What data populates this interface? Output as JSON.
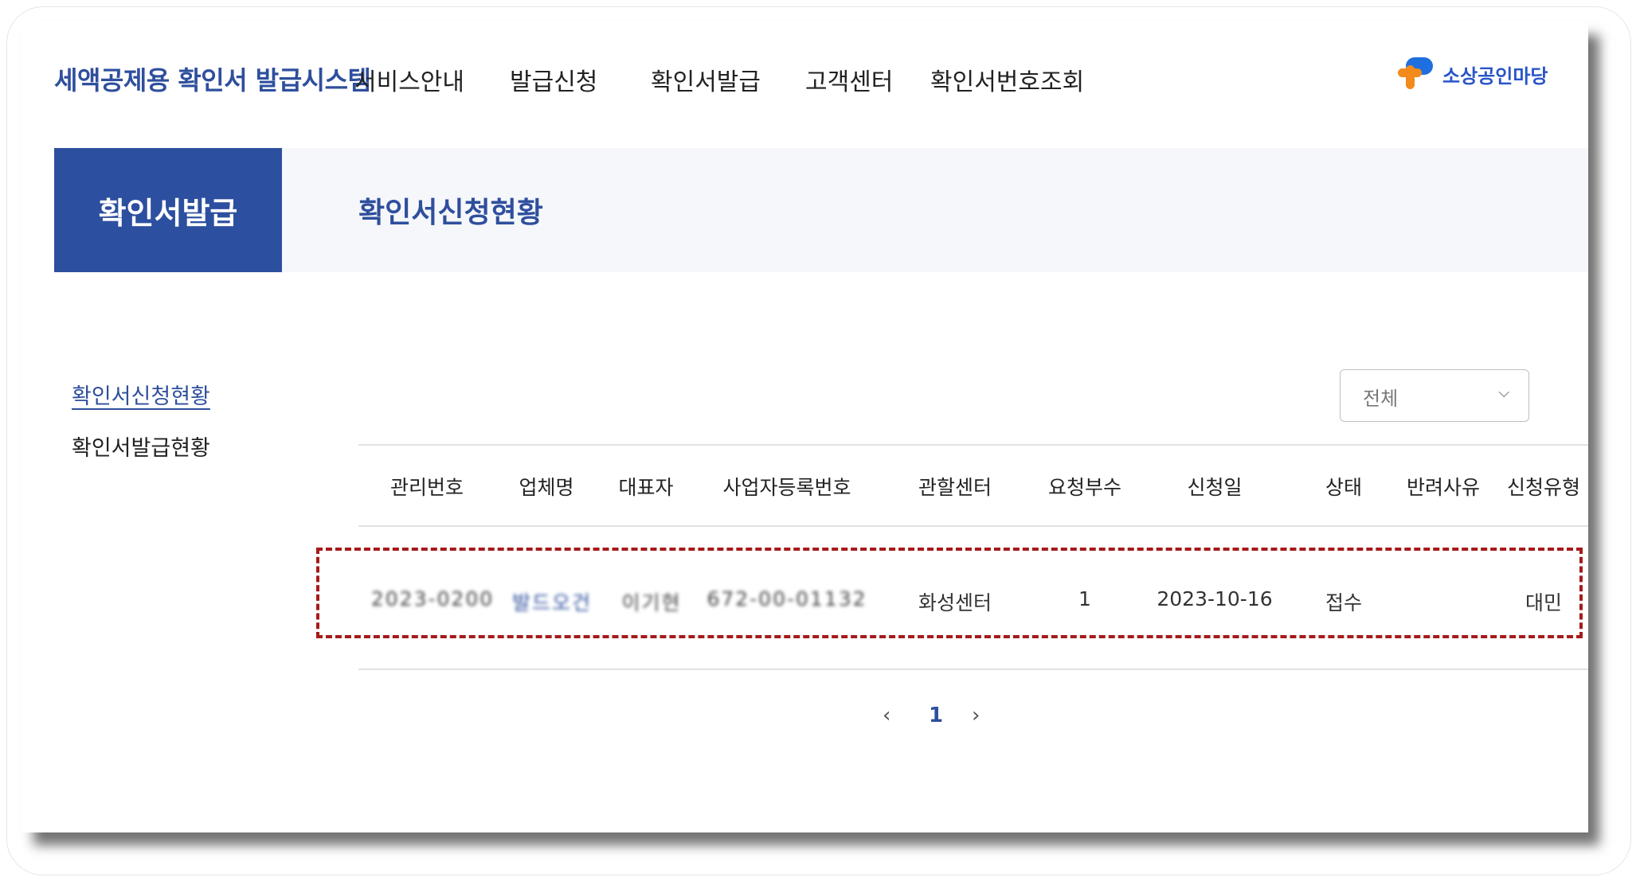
{
  "header": {
    "brand": "세액공제용 확인서 발급시스템",
    "nav": [
      "서비스안내",
      "발급신청",
      "확인서발급",
      "고객센터",
      "확인서번호조회"
    ],
    "logo_text": "소상공인마당"
  },
  "banner": {
    "active_tab": "확인서발급",
    "title": "확인서신청현황"
  },
  "side_menu": [
    "확인서신청현황",
    "확인서발급현황"
  ],
  "filter": {
    "selected": "전체"
  },
  "table": {
    "headers": [
      "관리번호",
      "업체명",
      "대표자",
      "사업자등록번호",
      "관할센터",
      "요청부수",
      "신청일",
      "상태",
      "반려사유",
      "신청유형"
    ],
    "rows": [
      {
        "id": "2023-0200",
        "company": "발드오건",
        "representative": "이기현",
        "bizno": "672-00-01132",
        "center": "화성센터",
        "copies": "1",
        "date": "2023-10-16",
        "status": "접수",
        "reason": "",
        "type": "대민"
      }
    ]
  },
  "pagination": {
    "prev": "‹",
    "current": "1",
    "next": "›"
  },
  "colors": {
    "brand": "#2f4f9d",
    "highlight": "#a61a1a"
  }
}
